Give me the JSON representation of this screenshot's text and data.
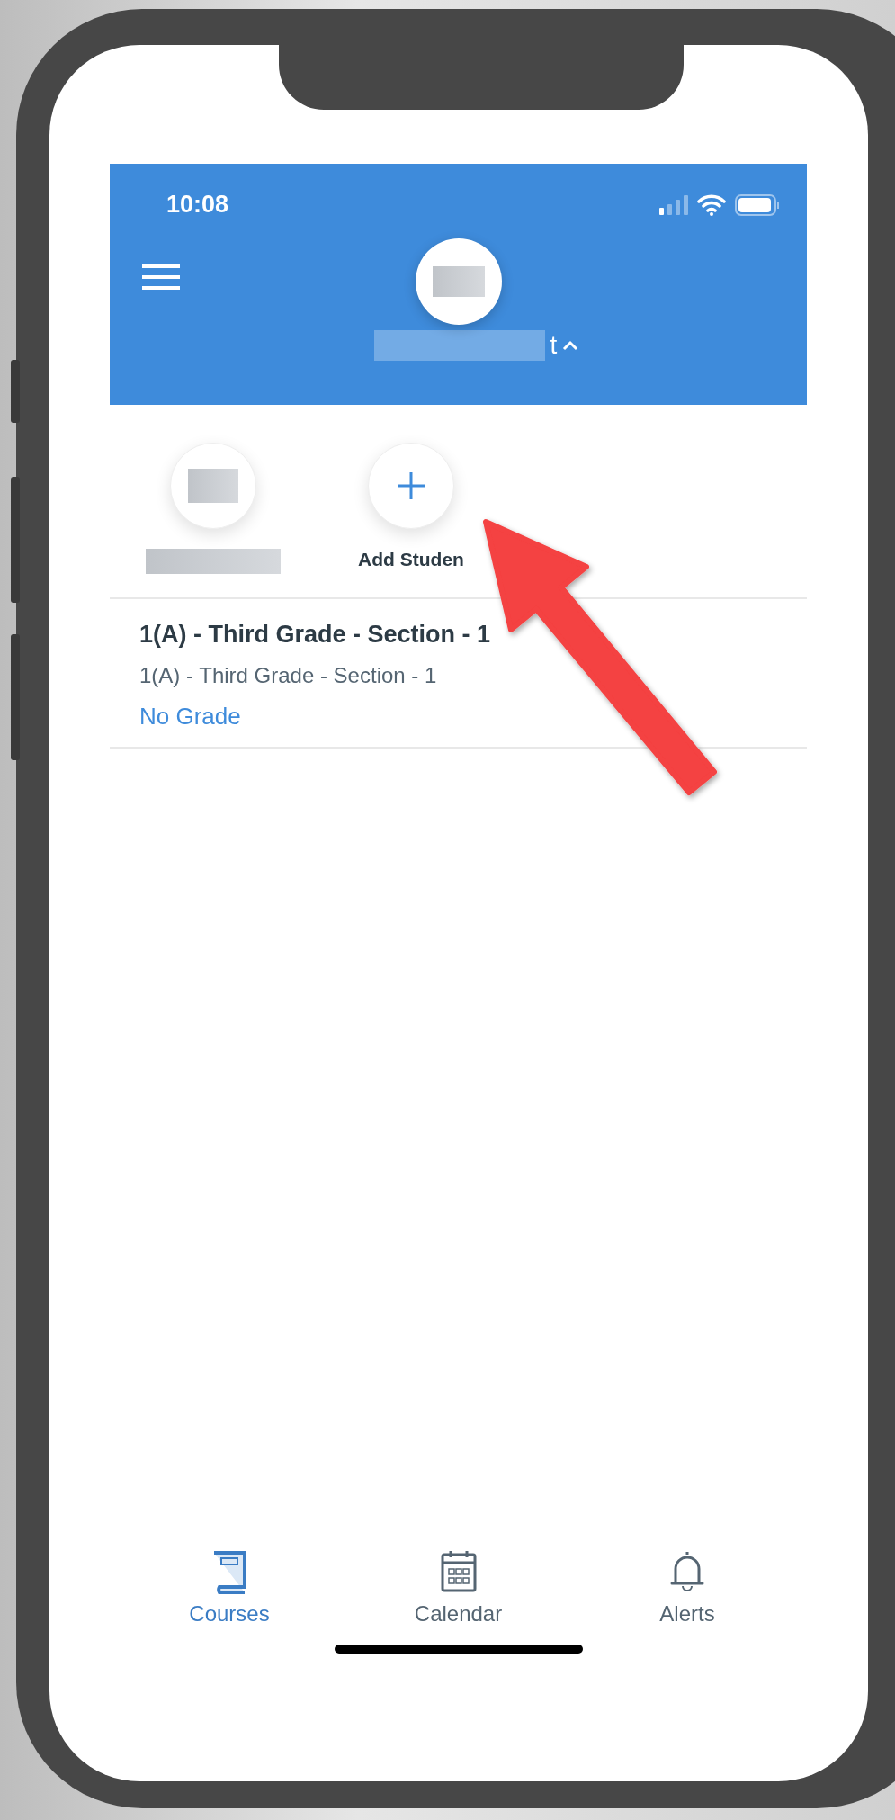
{
  "status_bar": {
    "time": "10:08"
  },
  "header": {
    "name_visible": "t"
  },
  "students": [
    {
      "kind": "student"
    },
    {
      "kind": "add",
      "label": "Add Studen"
    }
  ],
  "courses": [
    {
      "title": "1(A) - Third Grade - Section - 1",
      "subtitle": "1(A) - Third Grade - Section - 1",
      "grade": "No Grade"
    }
  ],
  "tabs": [
    {
      "label": "Courses",
      "selected": true
    },
    {
      "label": "Calendar",
      "selected": false
    },
    {
      "label": "Alerts",
      "selected": false
    }
  ]
}
